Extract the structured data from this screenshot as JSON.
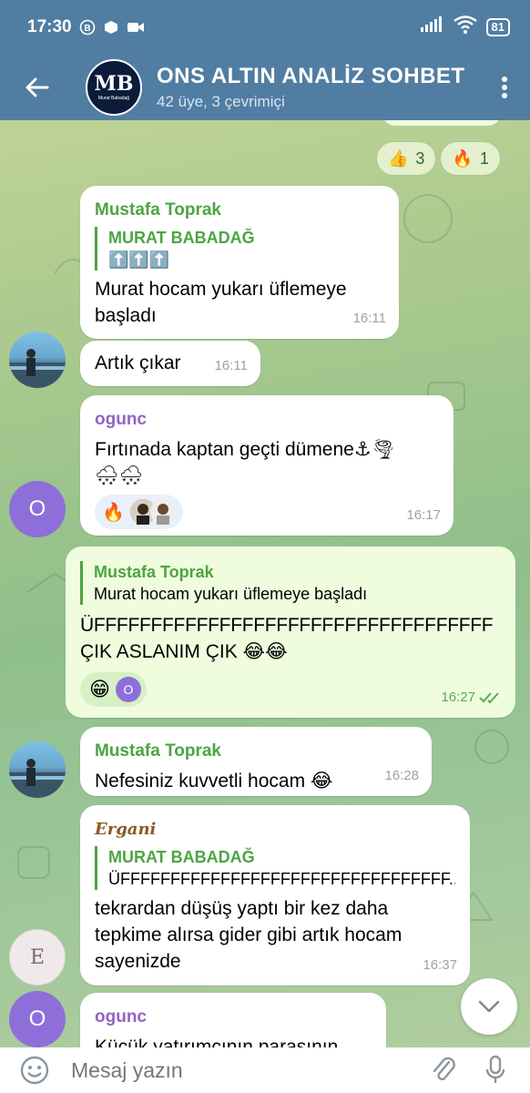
{
  "status": {
    "time": "17:30",
    "battery": "81"
  },
  "header": {
    "title": "ONS ALTIN ANALİZ SOHBET",
    "subtitle": "42 üye, 3 çevrimiçi",
    "avatar_mark": "MB",
    "avatar_caption": "Murat Babadağ"
  },
  "top_reactions": [
    {
      "emoji": "👍",
      "count": "3"
    },
    {
      "emoji": "🔥",
      "count": "1"
    }
  ],
  "messages": [
    {
      "sender": "Mustafa Toprak",
      "reply_name": "MURAT BABADAĞ",
      "reply_text": "⬆️⬆️⬆️",
      "text": "Murat hocam yukarı üflemeye başladı",
      "time": "16:11"
    },
    {
      "text": "Artık çıkar",
      "time": "16:11"
    },
    {
      "sender": "ogunc",
      "avatar_letter": "O",
      "text_line1": "Fırtınada kaptan geçti dümene⚓🌪",
      "text_line2": "🌨🌨",
      "reaction": "🔥",
      "time": "16:17"
    },
    {
      "reply_name": "Mustafa Toprak",
      "reply_text": "Murat hocam yukarı üflemeye başladı",
      "text_line1": "ÜFFFFFFFFFFFFFFFFFFFFFFFFFFFFFFFFFFF",
      "text_line2": "ÇIK ASLANIM ÇIK 😂😂",
      "reaction": "😁",
      "reactor_letter": "O",
      "time": "16:27"
    },
    {
      "sender": "Mustafa Toprak",
      "text": "Nefesiniz kuvvetli hocam 😂",
      "time": "16:28"
    },
    {
      "sender": "Ergani",
      "reply_name": "MURAT BABADAĞ",
      "reply_text": "ÜFFFFFFFFFFFFFFFFFFFFFFFFFFFFFFFFF...",
      "text_line1": "tekrardan düşüş yaptı bir kez daha",
      "text_line2": "tepkime alırsa gider gibi artık hocam",
      "text_line3": "sayenizde",
      "avatar_letter": "E",
      "time": "16:37"
    },
    {
      "sender": "ogunc",
      "avatar_letter": "O",
      "text": "Küçük yatırımcının parasının"
    }
  ],
  "input": {
    "placeholder": "Mesaj yazın"
  }
}
